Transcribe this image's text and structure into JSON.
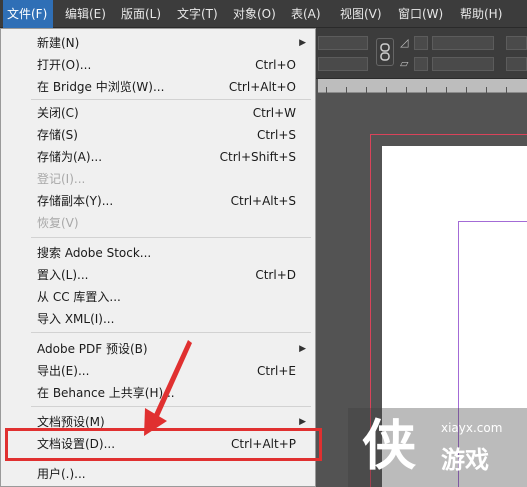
{
  "menubar": {
    "items": [
      {
        "label": "文件(F)",
        "active": true
      },
      {
        "label": "编辑(E)"
      },
      {
        "label": "版面(L)"
      },
      {
        "label": "文字(T)"
      },
      {
        "label": "对象(O)"
      },
      {
        "label": "表(A)"
      },
      {
        "label": "视图(V)"
      },
      {
        "label": "窗口(W)"
      },
      {
        "label": "帮助(H)"
      }
    ]
  },
  "file_menu": {
    "items": [
      {
        "label": "新建(N)",
        "shortcut": "",
        "submenu": true,
        "disabled": false
      },
      {
        "label": "打开(O)...",
        "shortcut": "Ctrl+O",
        "submenu": false,
        "disabled": false
      },
      {
        "label": "在 Bridge 中浏览(W)...",
        "shortcut": "Ctrl+Alt+O",
        "submenu": false,
        "disabled": false
      },
      {
        "label": "关闭(C)",
        "shortcut": "Ctrl+W",
        "submenu": false,
        "disabled": false
      },
      {
        "label": "存储(S)",
        "shortcut": "Ctrl+S",
        "submenu": false,
        "disabled": false
      },
      {
        "label": "存储为(A)...",
        "shortcut": "Ctrl+Shift+S",
        "submenu": false,
        "disabled": false
      },
      {
        "label": "登记(I)...",
        "shortcut": "",
        "submenu": false,
        "disabled": true
      },
      {
        "label": "存储副本(Y)...",
        "shortcut": "Ctrl+Alt+S",
        "submenu": false,
        "disabled": false
      },
      {
        "label": "恢复(V)",
        "shortcut": "",
        "submenu": false,
        "disabled": true
      },
      {
        "label": "搜索 Adobe Stock...",
        "shortcut": "",
        "submenu": false,
        "disabled": false
      },
      {
        "label": "置入(L)...",
        "shortcut": "Ctrl+D",
        "submenu": false,
        "disabled": false
      },
      {
        "label": "从 CC 库置入...",
        "shortcut": "",
        "submenu": false,
        "disabled": false
      },
      {
        "label": "导入 XML(I)...",
        "shortcut": "",
        "submenu": false,
        "disabled": false
      },
      {
        "label": "Adobe PDF 预设(B)",
        "shortcut": "",
        "submenu": true,
        "disabled": false
      },
      {
        "label": "导出(E)...",
        "shortcut": "Ctrl+E",
        "submenu": false,
        "disabled": false
      },
      {
        "label": "在 Behance 上共享(H)...",
        "shortcut": "",
        "submenu": false,
        "disabled": false
      },
      {
        "label": "文档预设(M)",
        "shortcut": "",
        "submenu": true,
        "disabled": false
      },
      {
        "label": "文档设置(D)...",
        "shortcut": "Ctrl+Alt+P",
        "submenu": false,
        "disabled": false,
        "highlighted": true
      },
      {
        "label": "用户(.)...",
        "shortcut": "",
        "submenu": false,
        "disabled": false
      }
    ]
  },
  "icons": {
    "submenu_arrow": "▶",
    "chain_link": "chain-link-icon",
    "rotate": "rotate-icon",
    "shear": "shear-icon"
  },
  "watermark": {
    "logo": "侠",
    "url": "xiayx.com",
    "title": "游戏"
  },
  "colors": {
    "highlight_box": "#e03030",
    "annotation_arrow": "#e03030",
    "menu_active": "#2f6fb6",
    "bleed_guide": "#d9435a",
    "margin_guide": "#a36bd6"
  }
}
